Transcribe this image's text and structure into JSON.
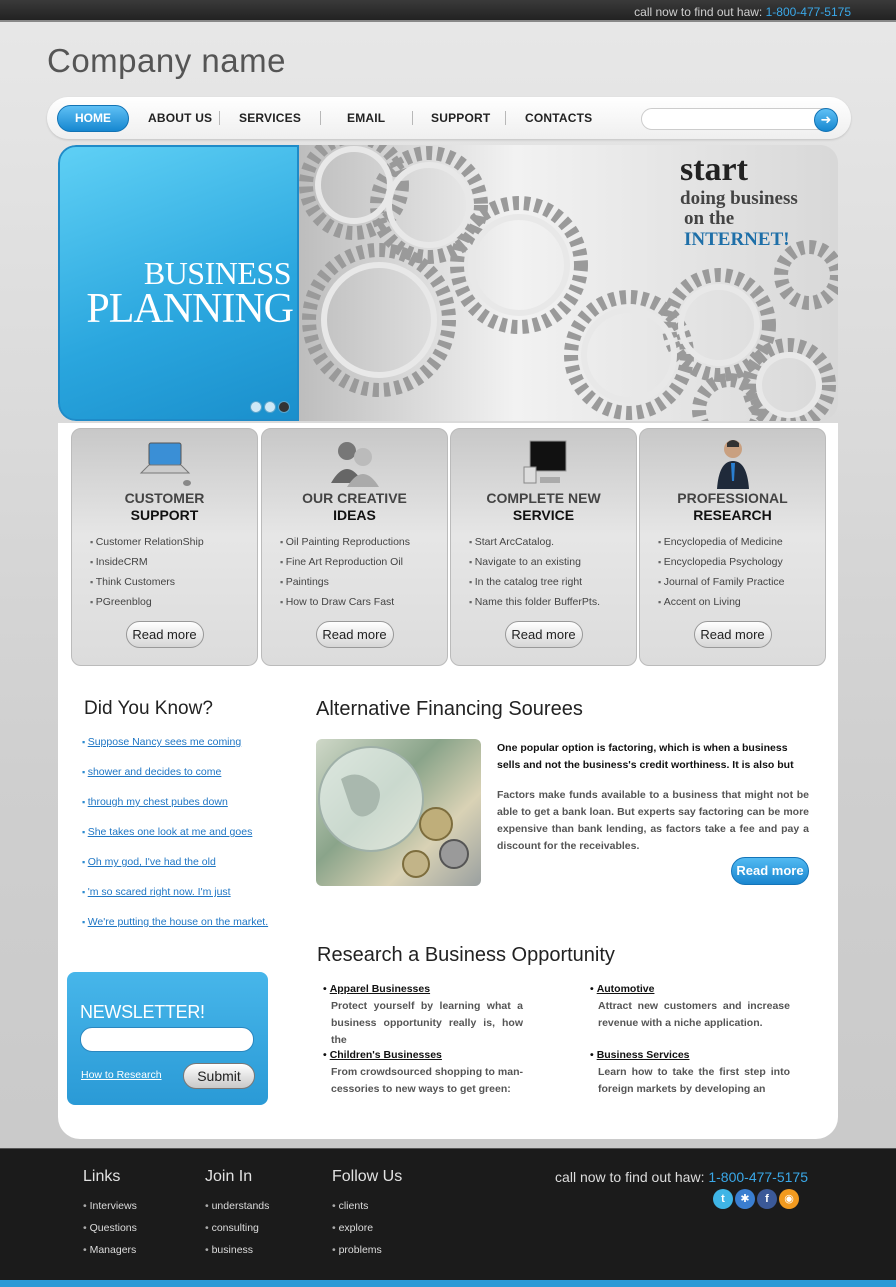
{
  "topbar": {
    "call_text": "call now to find out haw:",
    "phone": "1-800-477-5175"
  },
  "company_name": "Company name",
  "nav": {
    "items": [
      "HOME",
      "ABOUT US",
      "SERVICES",
      "EMAIL",
      "SUPPORT",
      "CONTACTS"
    ],
    "search_placeholder": ""
  },
  "banner": {
    "left_line1": "BUSINESS",
    "left_line2": "PLANNING",
    "right_line1": "start",
    "right_line2": "doing business",
    "right_line3": "on the",
    "right_line4": "INTERNET!"
  },
  "features": [
    {
      "title1": "CUSTOMER",
      "title2": "SUPPORT",
      "items": [
        "Customer RelationShip",
        "InsideCRM",
        "Think Customers",
        "PGreenblog"
      ],
      "button": "Read more"
    },
    {
      "title1": "OUR CREATIVE",
      "title2": "IDEAS",
      "items": [
        "Oil Painting Reproductions",
        "Fine Art Reproduction Oil",
        "Paintings",
        "How to Draw Cars Fast"
      ],
      "button": "Read more"
    },
    {
      "title1": "COMPLETE NEW",
      "title2": "SERVICE",
      "items": [
        "Start ArcCatalog.",
        "Navigate to an existing",
        "In the catalog tree right",
        "Name this folder BufferPts."
      ],
      "button": "Read more"
    },
    {
      "title1": "PROFESSIONAL",
      "title2": "RESEARCH",
      "items": [
        "Encyclopedia of Medicine",
        "Encyclopedia Psychology",
        "Journal of Family Practice",
        "Accent on Living"
      ],
      "button": "Read more"
    }
  ],
  "did_you_know": {
    "title": "Did You Know?",
    "links": [
      "Suppose Nancy sees me coming",
      "shower and decides to come",
      "through my chest pubes down",
      "She takes one look at me and goes",
      "Oh my god, I've had the old",
      "'m so scared right now. I'm just",
      "We're putting the house on the market."
    ]
  },
  "alt_financing": {
    "title": "Alternative Financing Sourees",
    "para1": "One popular option is factoring, which is when a business sells and not the business's credit worthiness. It is also but",
    "para2": "Factors make funds available to a business that might not be able to get a bank loan. But experts say factoring can be more expensive than bank lending, as factors take a fee and pay a discount for the receivables.",
    "button": "Read more"
  },
  "research": {
    "title": "Research a Business Opportunity",
    "items": [
      {
        "heading": "Apparel Businesses",
        "text": "Protect yourself by learning what a business opportunity really is, how the"
      },
      {
        "heading": "Automotive",
        "text": "Attract new customers and increase revenue with a niche application."
      },
      {
        "heading": "Children's Businesses",
        "text": "From crowdsourced shopping to man-cessories to new ways to get green:"
      },
      {
        "heading": "Business Services",
        "text": "Learn how to take the first step into foreign markets by developing an"
      }
    ]
  },
  "newsletter": {
    "title": "NEWSLETTER!",
    "link": "How to Research",
    "button": "Submit"
  },
  "footer": {
    "links": {
      "title": "Links",
      "items": [
        "Interviews",
        "Questions",
        "Managers"
      ]
    },
    "join": {
      "title": "Join In",
      "items": [
        "understands",
        "consulting",
        "business"
      ]
    },
    "follow": {
      "title": "Follow Us",
      "items": [
        "clients",
        "explore",
        "problems"
      ]
    },
    "call_text": "call now to find out haw:",
    "phone": "1-800-477-5175",
    "social_icons": [
      "twitter-icon",
      "delicious-icon",
      "facebook-icon",
      "rss-icon"
    ]
  }
}
